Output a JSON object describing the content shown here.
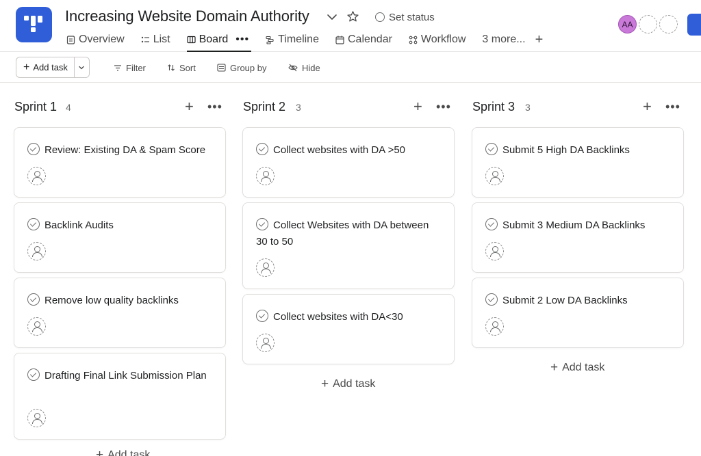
{
  "header": {
    "project_title": "Increasing Website Domain Authority",
    "set_status_label": "Set status",
    "tabs": [
      {
        "label": "Overview",
        "icon": "overview-icon"
      },
      {
        "label": "List",
        "icon": "list-icon"
      },
      {
        "label": "Board",
        "icon": "board-icon",
        "active": true
      },
      {
        "label": "Timeline",
        "icon": "timeline-icon"
      },
      {
        "label": "Calendar",
        "icon": "calendar-icon"
      },
      {
        "label": "Workflow",
        "icon": "workflow-icon"
      },
      {
        "label": "3 more..."
      }
    ],
    "avatar_initials": "AA",
    "colors": {
      "brand": "#2f5ed8",
      "avatar": "#c97ad9"
    }
  },
  "toolbar": {
    "add_task_label": "Add task",
    "filter_label": "Filter",
    "sort_label": "Sort",
    "group_by_label": "Group by",
    "hide_label": "Hide"
  },
  "board": {
    "columns": [
      {
        "title": "Sprint 1",
        "count": "4",
        "tasks": [
          "Review: Existing DA & Spam Score",
          "Backlink Audits",
          "Remove low quality backlinks",
          "Drafting Final Link Submission Plan"
        ],
        "add_task_label": "Add task"
      },
      {
        "title": "Sprint 2",
        "count": "3",
        "tasks": [
          "Collect websites with DA >50",
          "Collect Websites with DA between 30 to 50",
          "Collect websites with DA<30"
        ],
        "add_task_label": "Add task"
      },
      {
        "title": "Sprint 3",
        "count": "3",
        "tasks": [
          "Submit 5 High DA Backlinks",
          "Submit 3 Medium DA Backlinks",
          "Submit 2 Low DA Backlinks"
        ],
        "add_task_label": "Add task"
      }
    ]
  }
}
